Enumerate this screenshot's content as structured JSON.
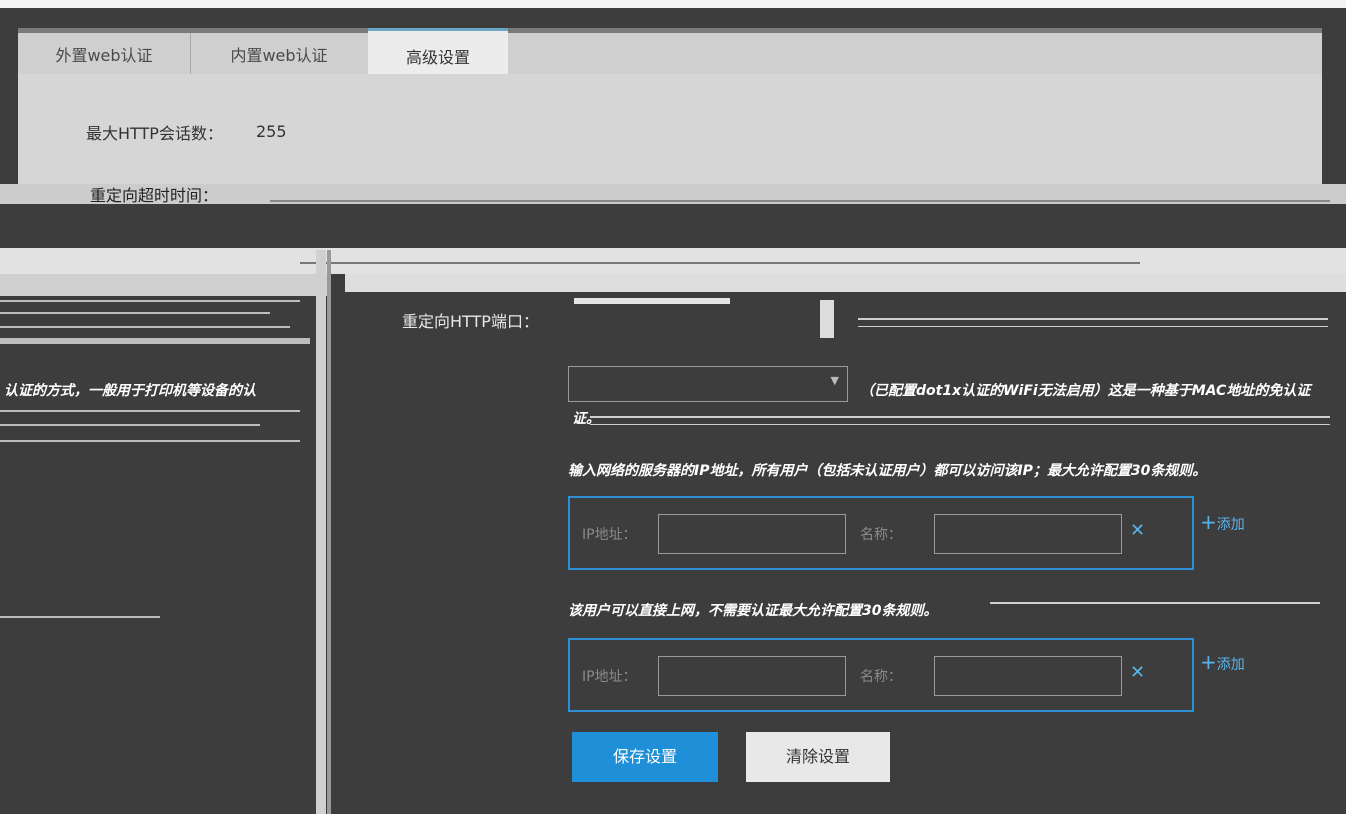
{
  "tabs": [
    {
      "label": "外置web认证"
    },
    {
      "label": "内置web认证"
    },
    {
      "label": "高级设置"
    }
  ],
  "max_sessions": {
    "label": "最大HTTP会话数：",
    "value": "255"
  },
  "redirect_interval": {
    "label": "重定向超时时间："
  },
  "redirect_port": {
    "label": "重定向HTTP端口："
  },
  "mac_bypass": {
    "desc_line1": "（已配置dot1x认证的WiFi无法启用）这是一种基于MAC地址的免认证",
    "desc_line2": "证。"
  },
  "left_desc": "认证的方式，一般用于打印机等设备的认",
  "free_servers": {
    "desc": "输入网络的服务器的IP地址，所有用户（包括未认证用户）都可以访问该IP；最大允许配置30条规则。",
    "ip_label": "IP地址：",
    "name_label": "名称：",
    "add_label": "添加"
  },
  "free_users": {
    "desc": "该用户可以直接上网，不需要认证最大允许配置30条规则。",
    "ip_label": "IP地址：",
    "name_label": "名称：",
    "add_label": "添加"
  },
  "buttons": {
    "save": "保存设置",
    "clear": "清除设置"
  }
}
